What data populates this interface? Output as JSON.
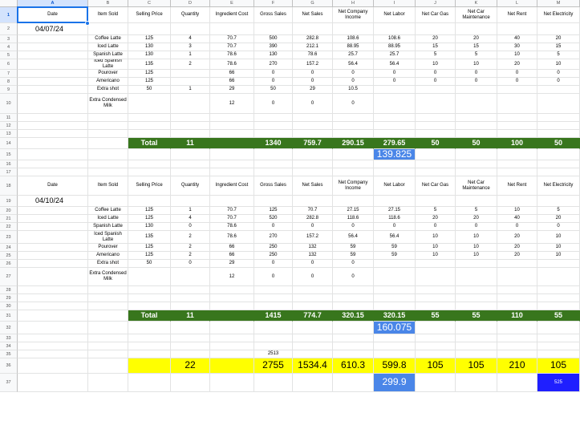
{
  "columns": [
    "A",
    "B",
    "C",
    "D",
    "E",
    "F",
    "G",
    "H",
    "I",
    "J",
    "K",
    "L",
    "M"
  ],
  "headers": [
    "Date",
    "Item Sold",
    "Selling Price",
    "Quantity",
    "Ingredient Cost",
    "Gross Sales",
    "Net Sales",
    "Net Company Income",
    "Net Labor",
    "Net Car Gas",
    "Net Car Maintenance",
    "Net Rent",
    "Net Electricity"
  ],
  "row_numbers": [
    "1",
    "2",
    "3",
    "4",
    "5",
    "6",
    "7",
    "8",
    "9",
    "10",
    "11",
    "12",
    "13",
    "14",
    "15",
    "16",
    "17",
    "18",
    "19",
    "20",
    "21",
    "22",
    "23",
    "24",
    "25",
    "26",
    "27",
    "28",
    "29",
    "30",
    "31",
    "32",
    "33",
    "34",
    "35",
    "36",
    "37"
  ],
  "week1": {
    "date": "04/07/24",
    "items": [
      [
        "Coffee Latte",
        "125",
        "4",
        "70.7",
        "500",
        "282.8",
        "108.6",
        "108.6",
        "20",
        "20",
        "40",
        "20"
      ],
      [
        "Iced Latte",
        "130",
        "3",
        "70.7",
        "390",
        "212.1",
        "88.95",
        "88.95",
        "15",
        "15",
        "30",
        "15"
      ],
      [
        "Spanish Latte",
        "130",
        "1",
        "78.6",
        "130",
        "78.6",
        "25.7",
        "25.7",
        "5",
        "5",
        "10",
        "5"
      ],
      [
        "Iced Spanish Latte",
        "135",
        "2",
        "78.6",
        "270",
        "157.2",
        "56.4",
        "56.4",
        "10",
        "10",
        "20",
        "10"
      ],
      [
        "Pourover",
        "125",
        "",
        "66",
        "0",
        "0",
        "0",
        "0",
        "0",
        "0",
        "0",
        "0"
      ],
      [
        "Americano",
        "125",
        "",
        "66",
        "0",
        "0",
        "0",
        "0",
        "0",
        "0",
        "0",
        "0"
      ],
      [
        "Extra shot",
        "50",
        "1",
        "29",
        "50",
        "29",
        "10.5",
        "",
        "",
        "",
        "",
        ""
      ],
      [
        "Extra Condensed Milk",
        "",
        "",
        "12",
        "0",
        "0",
        "0",
        "",
        "",
        "",
        "",
        ""
      ]
    ],
    "total_label": "Total",
    "totals": [
      "11",
      "1340",
      "759.7",
      "290.15",
      "279.65",
      "50",
      "50",
      "100",
      "50"
    ],
    "labor_sub": "139.825"
  },
  "week2": {
    "date": "04/10/24",
    "items": [
      [
        "Coffee Latte",
        "125",
        "1",
        "70.7",
        "125",
        "70.7",
        "27.15",
        "27.15",
        "5",
        "5",
        "10",
        "5"
      ],
      [
        "Iced Latte",
        "125",
        "4",
        "70.7",
        "520",
        "282.8",
        "118.6",
        "118.6",
        "20",
        "20",
        "40",
        "20"
      ],
      [
        "Spanish Latte",
        "130",
        "0",
        "78.6",
        "0",
        "0",
        "0",
        "0",
        "0",
        "0",
        "0",
        "0"
      ],
      [
        "Iced Spanish Latte",
        "135",
        "2",
        "78.6",
        "270",
        "157.2",
        "56.4",
        "56.4",
        "10",
        "10",
        "20",
        "10"
      ],
      [
        "Pourover",
        "125",
        "2",
        "66",
        "250",
        "132",
        "59",
        "59",
        "10",
        "10",
        "20",
        "10"
      ],
      [
        "Americano",
        "125",
        "2",
        "66",
        "250",
        "132",
        "59",
        "59",
        "10",
        "10",
        "20",
        "10"
      ],
      [
        "Extra shot",
        "50",
        "0",
        "29",
        "0",
        "0",
        "0",
        "",
        "",
        "",
        "",
        ""
      ],
      [
        "Extra Condensed Milk",
        "",
        "",
        "12",
        "0",
        "0",
        "0",
        "",
        "",
        "",
        "",
        ""
      ]
    ],
    "total_label": "Total",
    "totals": [
      "11",
      "1415",
      "774.7",
      "320.15",
      "320.15",
      "55",
      "55",
      "110",
      "55"
    ],
    "labor_sub": "160.075"
  },
  "summary": {
    "f35": "2513",
    "grand": [
      "22",
      "2755",
      "1534.4",
      "610.3",
      "599.8",
      "105",
      "105",
      "210",
      "105"
    ],
    "labor_sub": "299.9",
    "electric_sub": "525"
  }
}
